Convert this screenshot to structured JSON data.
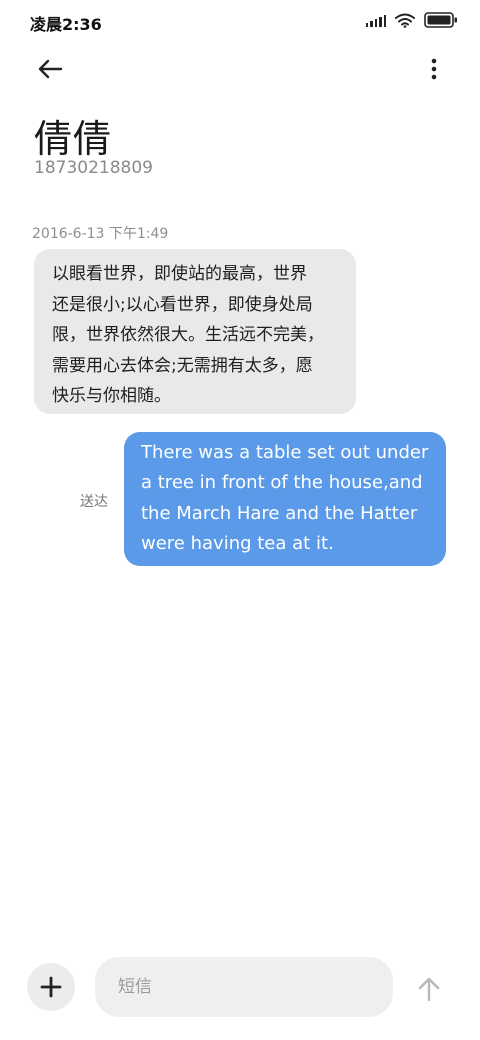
{
  "status_bar": {
    "time": "凌晨2:36",
    "icons": [
      "signal-icon",
      "wifi-icon",
      "battery-icon"
    ]
  },
  "header": {
    "back_icon": "back-arrow-icon",
    "more_icon": "more-vertical-icon"
  },
  "contact": {
    "name": "倩倩",
    "number": "18730218809"
  },
  "conversation": {
    "timestamp": "2016-6-13 下午1:49",
    "incoming": {
      "lines": [
        "以眼看世界，即使站的最高，世界",
        "还是很小;以心看世界，即使身处局",
        "限，世界依然很大。生活远不完美，",
        "需要用心去体会;无需拥有太多，愿",
        "快乐与你相随。"
      ]
    },
    "outgoing": {
      "status": "送达",
      "lines": [
        "There was a table set out under",
        "a tree in front of the house,and",
        "the March Hare and the Hatter",
        "were having tea at it."
      ]
    }
  },
  "composer": {
    "add_icon": "plus-icon",
    "placeholder": "短信",
    "value": "",
    "send_icon": "send-arrow-icon"
  },
  "colors": {
    "incoming_bubble": "#e9e9e9",
    "outgoing_bubble": "#5b9ae8",
    "background": "#ffffff"
  }
}
